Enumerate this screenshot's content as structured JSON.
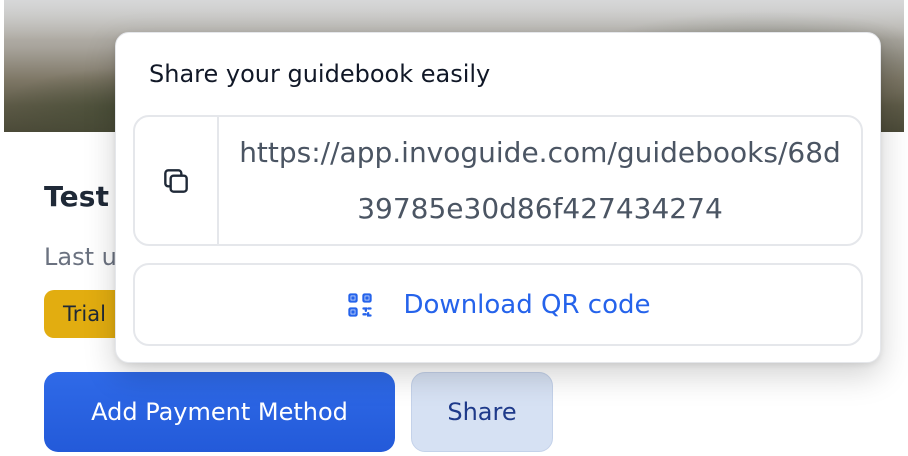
{
  "card": {
    "title": "Test",
    "subtitle": "Last u",
    "badge": "Trial",
    "primary_button": "Add Payment Method",
    "share_button": "Share"
  },
  "popover": {
    "title": "Share your guidebook easily",
    "link": "https://app.invoguide.com/guidebooks/68d39785e30d86f427434274",
    "copy_icon": "copy-icon",
    "qr_icon": "qr-code-icon",
    "qr_button": "Download QR code"
  },
  "colors": {
    "accent": "#2563eb",
    "primary_button": "#2f6ae8",
    "badge": "#e2ad10",
    "share_button_bg": "#d6e1f3"
  }
}
